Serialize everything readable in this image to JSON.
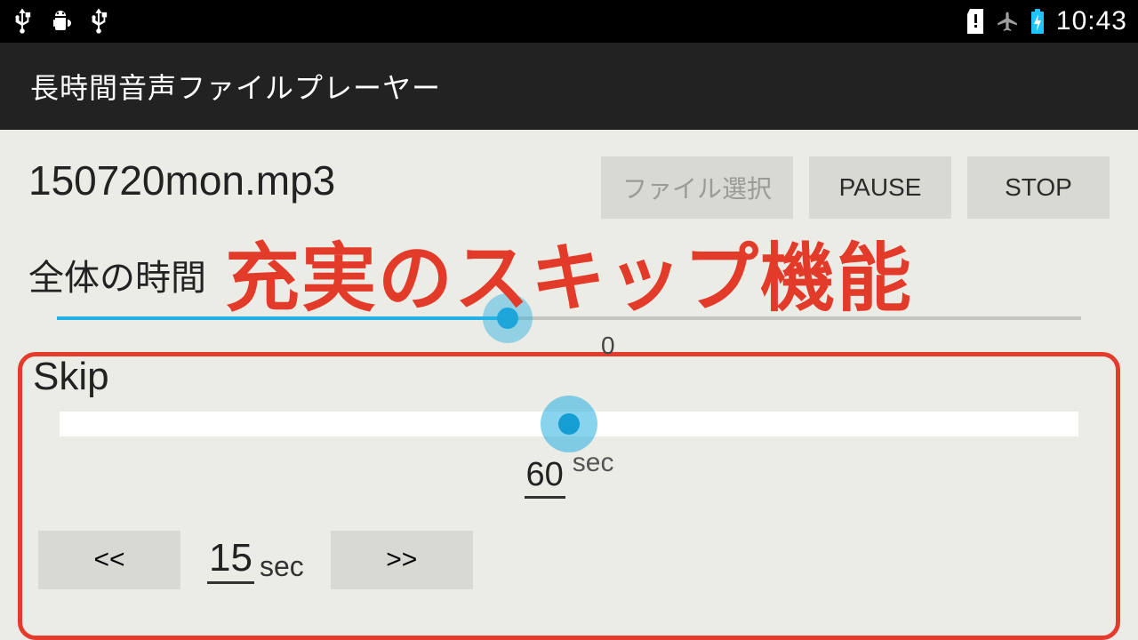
{
  "status_bar": {
    "clock": "10:43"
  },
  "action_bar": {
    "title": "長時間音声ファイルプレーヤー"
  },
  "file": {
    "name": "150720mon.mp3"
  },
  "buttons": {
    "choose_file": "ファイル選択",
    "pause": "PAUSE",
    "stop": "STOP"
  },
  "labels": {
    "total_time": "全体の時間",
    "skip": "Skip"
  },
  "timeline": {
    "percent": 44
  },
  "skip": {
    "slider_value": "0",
    "slider_percent": 50,
    "step_value": "60",
    "step_unit": "sec",
    "quick_value": "15",
    "quick_unit": "sec",
    "back_label": "<<",
    "fwd_label": ">>"
  },
  "overlay": {
    "headline": "充実のスキップ機能"
  }
}
